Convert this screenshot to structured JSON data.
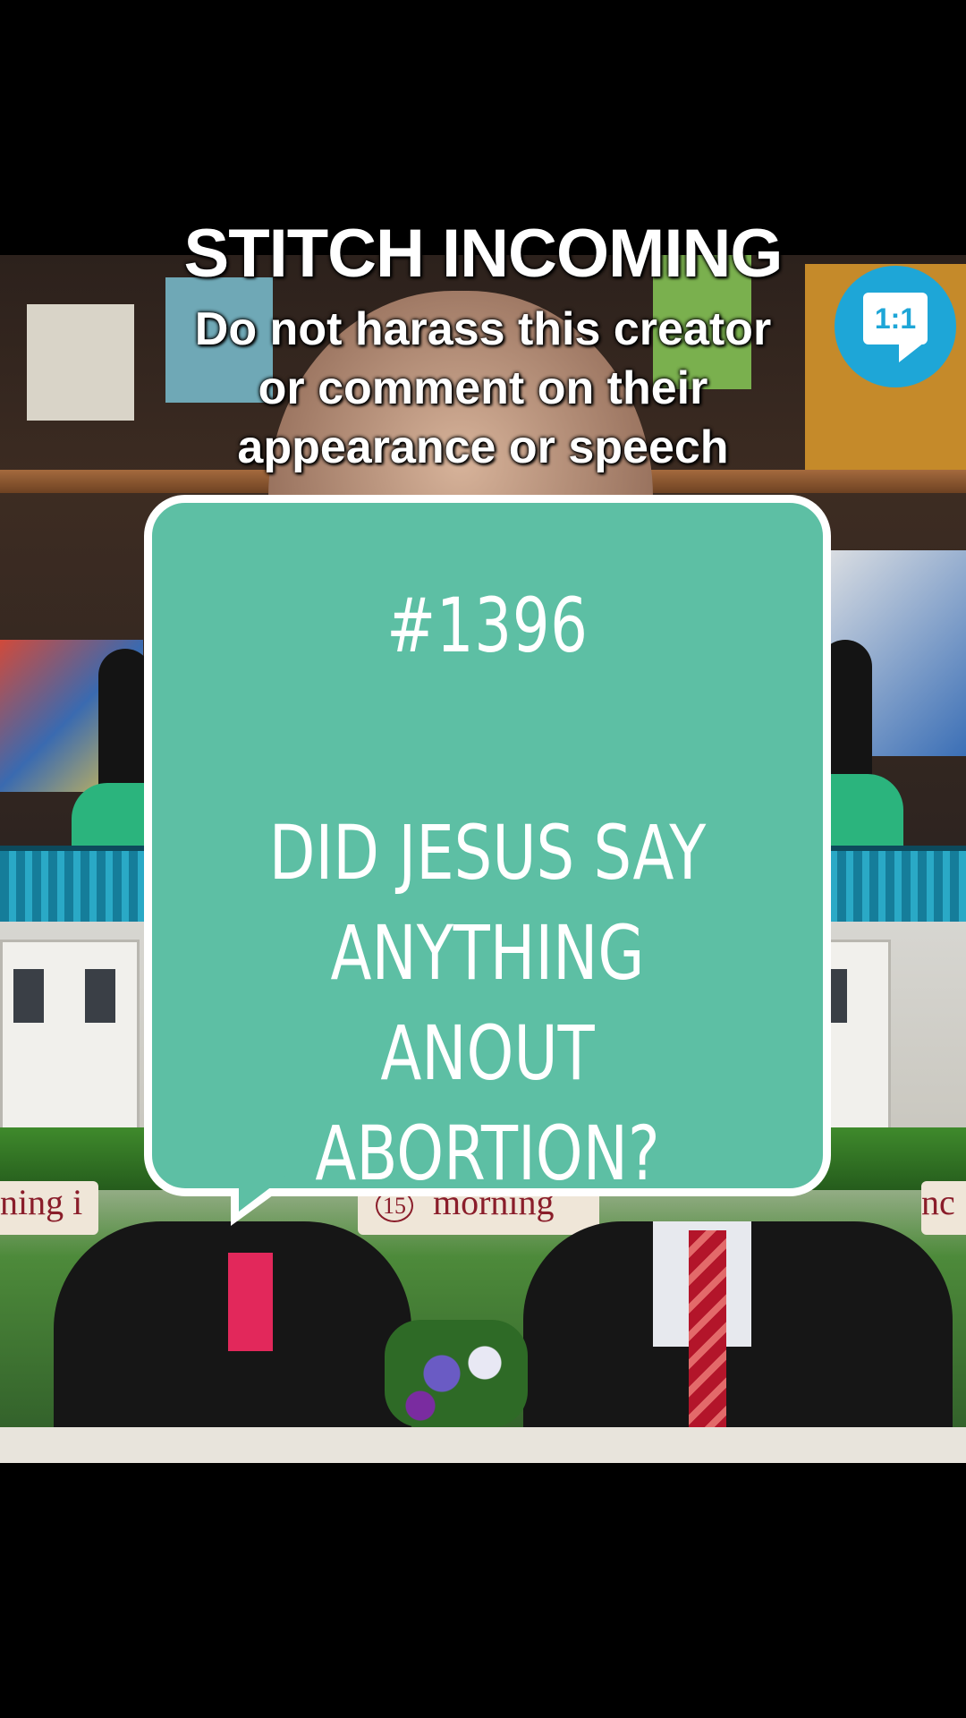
{
  "overlay": {
    "title": "STITCH INCOMING",
    "warning_lines": [
      "Do not harass this creator",
      "or comment on their",
      "appearance or speech"
    ]
  },
  "badge": {
    "label": "1:1"
  },
  "bubble": {
    "number": "#1396",
    "question_lines": [
      "DID JESUS SAY",
      "ANYTHING ANOUT",
      "ABORTION?"
    ]
  },
  "background": {
    "banner_left_text": "ning i",
    "banner_center_text": "morning",
    "banner_center_badge": "15",
    "banner_right_text": "nc"
  },
  "colors": {
    "bubble_fill": "#5dbfa4",
    "badge_fill": "#1ea6d7"
  }
}
